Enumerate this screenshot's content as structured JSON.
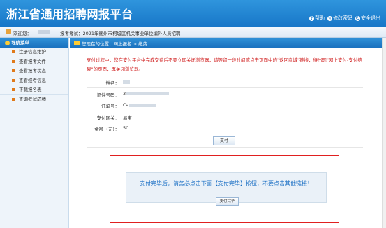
{
  "header": {
    "title": "浙江省通用招聘网报平台",
    "links": [
      {
        "icon": "help-icon",
        "label": "帮助"
      },
      {
        "icon": "password-icon",
        "label": "修改密码"
      },
      {
        "icon": "logout-icon",
        "label": "安全退出"
      }
    ]
  },
  "userbar": {
    "welcome": "欢迎您：",
    "exam_label": "报考考试：2021年衢州市柯城区机关事业单位编外人员招聘"
  },
  "sidebar": {
    "title": "导航菜单",
    "items": [
      {
        "label": "注册信息维护"
      },
      {
        "label": "查看报考文件"
      },
      {
        "label": "查看报考状态"
      },
      {
        "label": "查看报考信息"
      },
      {
        "label": "下载报名表"
      },
      {
        "label": "查询考试成绩"
      }
    ]
  },
  "breadcrumb": {
    "text": "您现在的位置：网上报名 > 缴费"
  },
  "notice": "支付过程中，您在支付平台中完成交费后不要立即关闭浏览器，请等留一段时间或点击页面中的\"返回商城\"链接，待出现\"网上支付-支付结果\"的页面，再关闭浏览器。",
  "form": {
    "rows": [
      {
        "label": "姓名："
      },
      {
        "label": "证件号码："
      },
      {
        "label": "订单号："
      },
      {
        "label": "支付网关：",
        "value": "易宝"
      },
      {
        "label": "金额（元）：",
        "value": "50"
      }
    ],
    "id_partial": "3",
    "order_partial": "Ca",
    "pay_button": "支付"
  },
  "dialog": {
    "message": "支付完毕后，请务必点击下面【支付完毕】按钮，不要点击其他链接！",
    "button": "支付完毕"
  }
}
